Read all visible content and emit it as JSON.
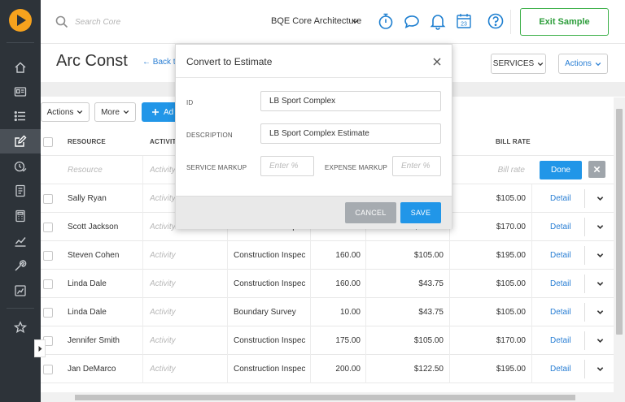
{
  "colors": {
    "accent": "#2196e8",
    "exit_green": "#3db04a",
    "sidebar": "#2d3339",
    "logo": "#f6a21d"
  },
  "sidebar": {
    "items": [
      {
        "icon": "home-icon"
      },
      {
        "icon": "id-card-icon"
      },
      {
        "icon": "list-icon"
      },
      {
        "icon": "edit-icon",
        "active": true
      },
      {
        "icon": "clock-check-icon"
      },
      {
        "icon": "document-icon"
      },
      {
        "icon": "calculator-icon"
      },
      {
        "icon": "chart-icon"
      },
      {
        "icon": "wrench-icon"
      },
      {
        "icon": "report-icon"
      },
      {
        "icon": "star-icon"
      }
    ]
  },
  "header": {
    "search_placeholder": "Search Core",
    "company": "BQE Core Architecture",
    "calendar_day": "23",
    "exit_label": "Exit Sample"
  },
  "page": {
    "title": "Arc Const",
    "back_label": "← Back t",
    "services_label": "SERVICES",
    "actions_label": "Actions"
  },
  "toolbar": {
    "actions_label": "Actions",
    "more_label": "More",
    "add_label": "Ad"
  },
  "table": {
    "headers": {
      "resource": "RESOURCE",
      "activity": "ACTIVIT",
      "bill_rate": "BILL RATE"
    },
    "placeholders": {
      "resource": "Resource",
      "activity": "Activity",
      "bill_rate": "Bill rate"
    },
    "done_label": "Done",
    "detail_label": "Detail",
    "rows": [
      {
        "resource": "Sally Ryan",
        "activity": "Activity",
        "service": "",
        "hours": "",
        "cost": "",
        "bill": "$105.00"
      },
      {
        "resource": "Scott Jackson",
        "activity": "Activity",
        "service": "Construction Inspec",
        "hours": "160.00",
        "cost": "$105.00",
        "bill": "$170.00"
      },
      {
        "resource": "Steven Cohen",
        "activity": "Activity",
        "service": "Construction Inspec",
        "hours": "160.00",
        "cost": "$105.00",
        "bill": "$195.00"
      },
      {
        "resource": "Linda Dale",
        "activity": "Activity",
        "service": "Construction Inspec",
        "hours": "160.00",
        "cost": "$43.75",
        "bill": "$105.00"
      },
      {
        "resource": "Linda Dale",
        "activity": "Activity",
        "service": "Boundary Survey",
        "hours": "10.00",
        "cost": "$43.75",
        "bill": "$105.00"
      },
      {
        "resource": "Jennifer Smith",
        "activity": "Activity",
        "service": "Construction Inspec",
        "hours": "175.00",
        "cost": "$105.00",
        "bill": "$170.00"
      },
      {
        "resource": "Jan DeMarco",
        "activity": "Activity",
        "service": "Construction Inspec",
        "hours": "200.00",
        "cost": "$122.50",
        "bill": "$195.00"
      }
    ]
  },
  "modal": {
    "title": "Convert to Estimate",
    "id_label": "ID",
    "id_value": "LB Sport Complex",
    "description_label": "DESCRIPTION",
    "description_value": "LB Sport Complex Estimate",
    "service_markup_label": "SERVICE MARKUP",
    "service_markup_placeholder": "Enter %",
    "expense_markup_label": "EXPENSE MARKUP",
    "expense_markup_placeholder": "Enter %",
    "cancel_label": "CANCEL",
    "save_label": "SAVE"
  }
}
